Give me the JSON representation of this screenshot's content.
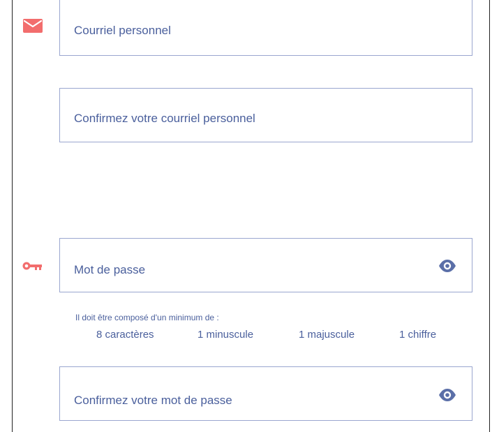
{
  "form": {
    "email": {
      "placeholder": "Courriel personnel"
    },
    "email_confirm": {
      "placeholder": "Confirmez votre courriel personnel"
    },
    "password": {
      "placeholder": "Mot de passe"
    },
    "password_confirm": {
      "placeholder": "Confirmez votre mot de passe"
    },
    "password_requirements": {
      "title": "Il doit être composé d'un minimum de :",
      "rules": [
        "8 caractères",
        "1 minuscule",
        "1 majuscule",
        "1 chiffre"
      ]
    }
  },
  "icons": {
    "email": "mail-icon",
    "password": "key-icon",
    "reveal": "eye-icon"
  },
  "colors": {
    "accent_icon": "#F26D6D",
    "field_border": "#9AA6CF",
    "text": "#4A5F9C",
    "eye_icon": "#5B6FA8"
  }
}
